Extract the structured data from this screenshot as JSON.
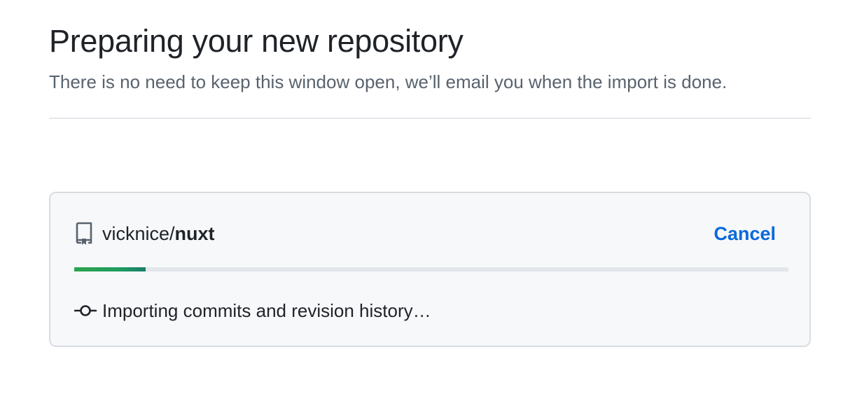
{
  "header": {
    "title": "Preparing your new repository",
    "subtitle": "There is no need to keep this window open, we’ll email you when the import is done."
  },
  "import": {
    "repo_icon": "repo-icon",
    "owner": "vicknice",
    "separator": "/",
    "repo": "nuxt",
    "cancel_label": "Cancel",
    "progress_percent": 10,
    "status_icon": "git-commit-icon",
    "status_text": "Importing commits and revision history…"
  },
  "colors": {
    "accent_link": "#0969da",
    "progress_green": "#2da44e",
    "box_background": "#f6f8fa",
    "muted_text": "#59636e"
  }
}
